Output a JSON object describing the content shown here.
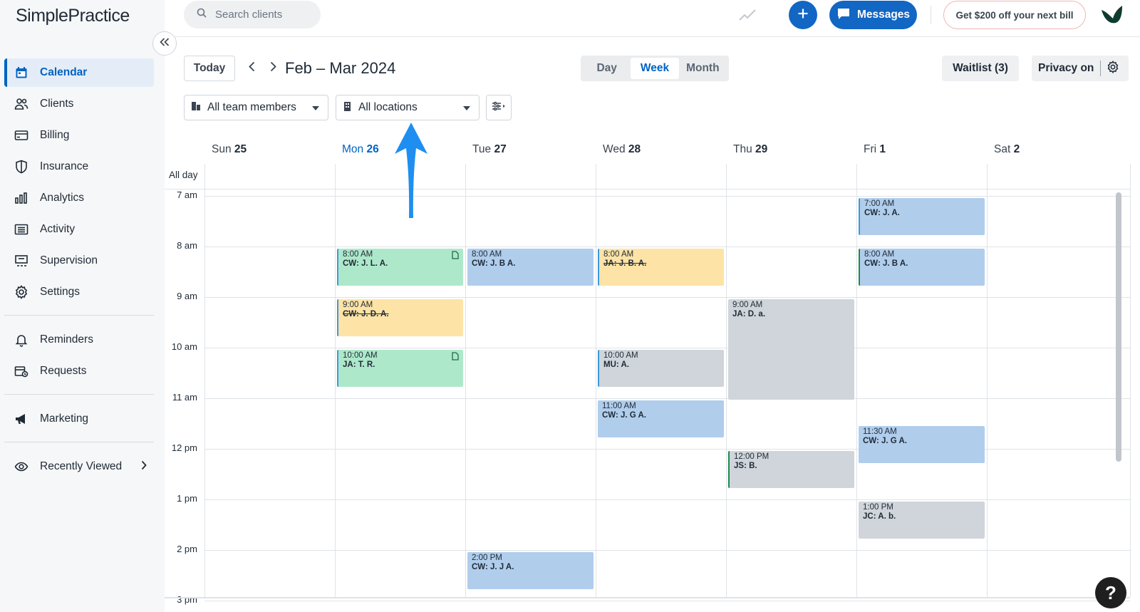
{
  "app": {
    "logo_text": "SimplePractice"
  },
  "sidebar": {
    "items": [
      {
        "label": "Calendar",
        "icon": "calendar-icon",
        "active": true
      },
      {
        "label": "Clients",
        "icon": "clients-icon"
      },
      {
        "label": "Billing",
        "icon": "billing-icon"
      },
      {
        "label": "Insurance",
        "icon": "shield-icon"
      },
      {
        "label": "Analytics",
        "icon": "analytics-icon"
      },
      {
        "label": "Activity",
        "icon": "activity-icon"
      },
      {
        "label": "Supervision",
        "icon": "supervision-icon"
      },
      {
        "label": "Settings",
        "icon": "gear-icon"
      }
    ],
    "secondary": [
      {
        "label": "Reminders",
        "icon": "bell-icon"
      },
      {
        "label": "Requests",
        "icon": "requests-icon"
      }
    ],
    "marketing": {
      "label": "Marketing",
      "icon": "megaphone-icon"
    },
    "recent": {
      "label": "Recently Viewed",
      "icon": "eye-icon"
    }
  },
  "topbar": {
    "search_placeholder": "Search clients",
    "messages_label": "Messages",
    "promo_label": "Get $200 off your next bill"
  },
  "toolbar": {
    "today_label": "Today",
    "range_title": "Feb – Mar 2024",
    "views": [
      "Day",
      "Week",
      "Month"
    ],
    "active_view": "Week",
    "waitlist_label": "Waitlist (3)",
    "privacy_label": "Privacy on",
    "team_filter": "All team members",
    "location_filter": "All locations"
  },
  "calendar": {
    "all_day_label": "All day",
    "days": [
      {
        "name": "Sun",
        "date": "25"
      },
      {
        "name": "Mon",
        "date": "26",
        "today": true
      },
      {
        "name": "Tue",
        "date": "27"
      },
      {
        "name": "Wed",
        "date": "28"
      },
      {
        "name": "Thu",
        "date": "29"
      },
      {
        "name": "Fri",
        "date": "1"
      },
      {
        "name": "Sat",
        "date": "2"
      }
    ],
    "hours": [
      "7 am",
      "8 am",
      "9 am",
      "10 am",
      "11 am",
      "12 pm",
      "1 pm",
      "2 pm",
      "3 pm"
    ],
    "events": [
      {
        "day": 1,
        "start": 8.0,
        "end": 8.75,
        "time": "8:00 AM",
        "name": "CW: J. L. A.",
        "color": "green",
        "accent": "blue",
        "doc": true
      },
      {
        "day": 1,
        "start": 9.0,
        "end": 9.75,
        "time": "9:00 AM",
        "name": "CW: J. D. A.",
        "color": "yellow",
        "accent": "blue",
        "strike": true
      },
      {
        "day": 1,
        "start": 10.0,
        "end": 10.75,
        "time": "10:00 AM",
        "name": "JA: T. R.",
        "color": "green",
        "accent": "blue",
        "doc": true
      },
      {
        "day": 2,
        "start": 8.0,
        "end": 8.75,
        "time": "8:00 AM",
        "name": "CW: J. B A.",
        "color": "blue"
      },
      {
        "day": 2,
        "start": 14.0,
        "end": 14.75,
        "time": "2:00 PM",
        "name": "CW: J. J A.",
        "color": "blue"
      },
      {
        "day": 3,
        "start": 8.0,
        "end": 8.75,
        "time": "8:00 AM",
        "name": "JA: J. B. A.",
        "color": "yellow",
        "accent": "blue",
        "strike": true
      },
      {
        "day": 3,
        "start": 10.0,
        "end": 10.75,
        "time": "10:00 AM",
        "name": "MU: A.",
        "color": "gray",
        "accent": "blue"
      },
      {
        "day": 3,
        "start": 11.0,
        "end": 11.75,
        "time": "11:00 AM",
        "name": "CW: J. G A.",
        "color": "blue"
      },
      {
        "day": 4,
        "start": 9.0,
        "end": 11.0,
        "time": "9:00 AM",
        "name": "JA: D. a.",
        "color": "gray"
      },
      {
        "day": 4,
        "start": 12.0,
        "end": 12.75,
        "time": "12:00 PM",
        "name": "JS: B.",
        "color": "gray",
        "accent": "green"
      },
      {
        "day": 5,
        "start": 7.0,
        "end": 7.75,
        "time": "7:00 AM",
        "name": "CW: J. A.",
        "color": "blue",
        "accent": "blue"
      },
      {
        "day": 5,
        "start": 8.0,
        "end": 8.75,
        "time": "8:00 AM",
        "name": "CW: J. B A.",
        "color": "blue",
        "accent": "green"
      },
      {
        "day": 5,
        "start": 11.5,
        "end": 12.25,
        "time": "11:30 AM",
        "name": "CW: J. G A.",
        "color": "blue"
      },
      {
        "day": 5,
        "start": 13.0,
        "end": 13.75,
        "time": "1:00 PM",
        "name": "JC: A. b.",
        "color": "gray"
      }
    ]
  },
  "help_label": "?"
}
